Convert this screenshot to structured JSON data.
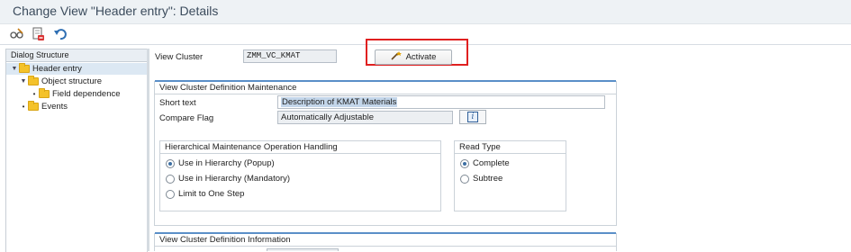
{
  "window": {
    "title": "Change View \"Header entry\": Details"
  },
  "toolbar": {
    "icons": [
      "glasses-pencil-icon",
      "delete-icon",
      "undo-icon"
    ]
  },
  "left_panel": {
    "header": "Dialog Structure",
    "tree": [
      {
        "label": "Header entry",
        "level": 0,
        "expanded": true,
        "selected": true
      },
      {
        "label": "Object structure",
        "level": 1,
        "expanded": true,
        "selected": false
      },
      {
        "label": "Field dependence",
        "level": 2,
        "expanded": false,
        "selected": false
      },
      {
        "label": "Events",
        "level": 1,
        "expanded": false,
        "selected": false
      }
    ]
  },
  "main": {
    "view_cluster_label": "View Cluster",
    "view_cluster_value": "ZMM_VC_KMAT",
    "activate_label": "Activate",
    "definition_section": {
      "title": "View Cluster Definition Maintenance",
      "short_text_label": "Short text",
      "short_text_value": "Description of KMAT Materials",
      "compare_flag_label": "Compare Flag",
      "compare_flag_value": "Automatically Adjustable"
    },
    "hierarchy_group": {
      "title": "Hierarchical Maintenance Operation Handling",
      "options": [
        {
          "label": "Use in Hierarchy (Popup)",
          "checked": true
        },
        {
          "label": "Use in Hierarchy (Mandatory)",
          "checked": false
        },
        {
          "label": "Limit to One Step",
          "checked": false
        }
      ]
    },
    "read_type_group": {
      "title": "Read Type",
      "options": [
        {
          "label": "Complete",
          "checked": true
        },
        {
          "label": "Subtree",
          "checked": false
        }
      ]
    },
    "info_section": {
      "title": "View Cluster Definition Information"
    }
  },
  "colors": {
    "highlight_border": "#e02020",
    "selection_bg": "#dce8f3",
    "folder": "#f4c22a",
    "accent": "#5a8fc8"
  }
}
